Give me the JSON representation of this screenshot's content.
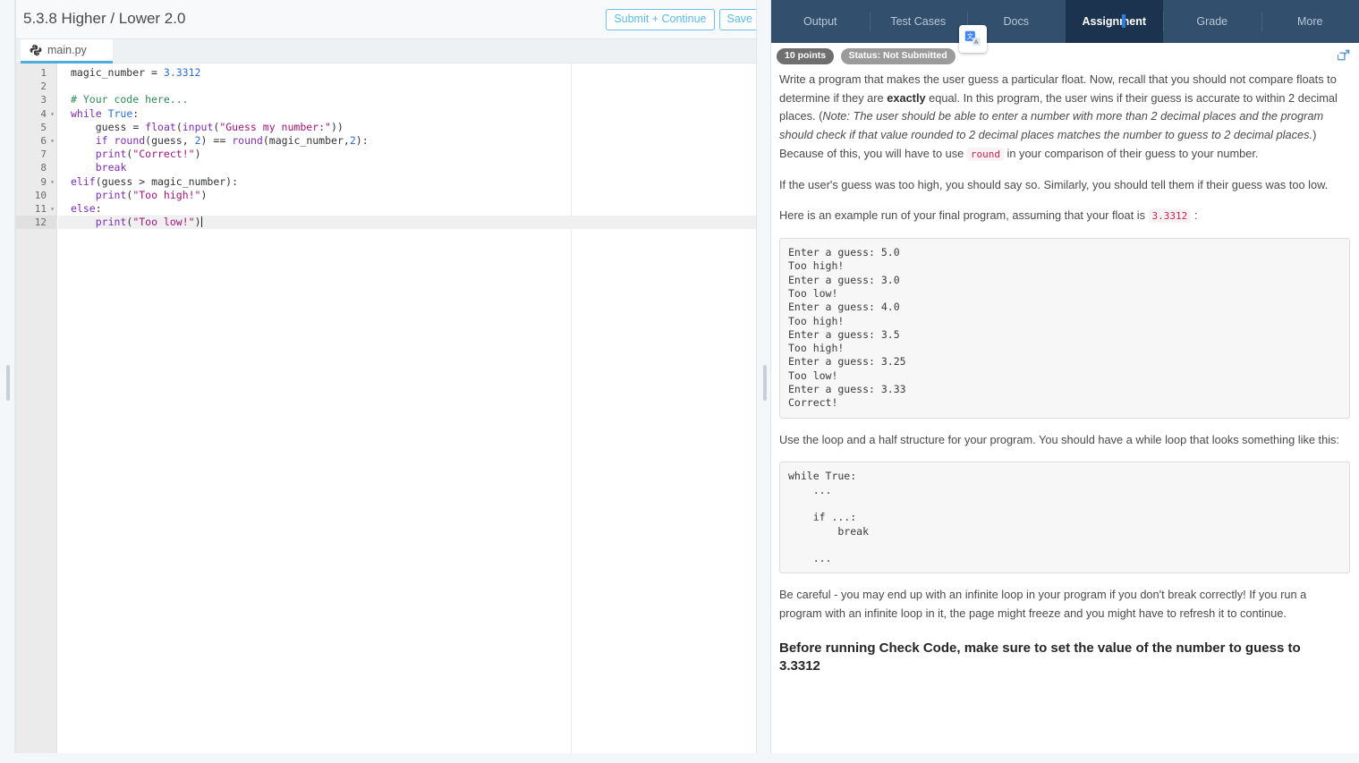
{
  "editor": {
    "title": "5.3.8 Higher / Lower 2.0",
    "submit_label": "Submit + Continue",
    "save_label": "Save",
    "file_tab": "main.py",
    "active_line": 12,
    "lines": [
      {
        "n": 1,
        "fold": false
      },
      {
        "n": 2,
        "fold": false
      },
      {
        "n": 3,
        "fold": false
      },
      {
        "n": 4,
        "fold": true
      },
      {
        "n": 5,
        "fold": false
      },
      {
        "n": 6,
        "fold": true
      },
      {
        "n": 7,
        "fold": false
      },
      {
        "n": 8,
        "fold": false
      },
      {
        "n": 9,
        "fold": true
      },
      {
        "n": 10,
        "fold": false
      },
      {
        "n": 11,
        "fold": true
      },
      {
        "n": 12,
        "fold": false
      }
    ],
    "code": [
      "magic_number = 3.3312",
      "",
      "# Your code here...",
      "while True:",
      "    guess = float(input(\"Guess my number:\"))",
      "    if round(guess, 2) == round(magic_number,2):",
      "    print(\"Correct!\")",
      "    break",
      "elif(guess > magic_number):",
      "    print(\"Too high!\")",
      "else:",
      "    print(\"Too low!\")"
    ]
  },
  "right_panel": {
    "tabs": [
      {
        "label": "Output",
        "active": false
      },
      {
        "label": "Test Cases",
        "active": false
      },
      {
        "label": "Docs",
        "active": false
      },
      {
        "label": "Assignment",
        "active": true
      },
      {
        "label": "Grade",
        "active": false
      },
      {
        "label": "More",
        "active": false
      }
    ],
    "points_badge": "10 points",
    "status_badge": "Status: Not Submitted",
    "popout_icon": "external-link-icon",
    "translate_icon": "google-translate-icon",
    "assignment": {
      "p1_a": "Write a program that makes the user guess a particular float. Now, recall that you should not compare floats to determine if they are ",
      "p1_bold": "exactly",
      "p1_b": " equal. In this program, the user wins if their guess is accurate to within 2 decimal places. (",
      "p1_note_lead": "Note:",
      "p1_note_italic": " The user should be able to enter a number with more than 2 decimal places and the program should check if that value rounded to 2 decimal places matches the number to guess to 2 decimal places.",
      "p1_c": ") Because of this, you will have to use ",
      "p1_code": "round",
      "p1_d": " in your comparison of their guess to your number.",
      "p2": "If the user's guess was too high, you should say so. Similarly, you should tell them if their guess was too low.",
      "p3_a": "Here is an example run of your final program, assuming that your float is ",
      "p3_code": "3.3312",
      "p3_b": " :",
      "example_output": "Enter a guess: 5.0\nToo high!\nEnter a guess: 3.0\nToo low!\nEnter a guess: 4.0\nToo high!\nEnter a guess: 3.5\nToo high!\nEnter a guess: 3.25\nToo low!\nEnter a guess: 3.33\nCorrect!",
      "p4": "Use the loop and a half structure for your program. You should have a while loop that looks something like this:",
      "loop_skeleton": "while True:\n    ...\n\n    if ...:\n        break\n\n    ...",
      "p5": "Be careful - you may end up with an infinite loop in your program if you don't break correctly! If you run a program with an infinite loop in it, the page might freeze and you might have to refresh it to continue.",
      "callout": "Before running Check Code, make sure to set the value of the number to guess to 3.3312"
    }
  },
  "colors": {
    "tabbar_bg": "#32506e",
    "tab_active_bg": "#1c3350",
    "accent_blue": "#4eabdc",
    "badge_points": "#6f6f6f",
    "badge_status": "#9b9b9b",
    "code_keyword": "#7e2ab5",
    "code_string": "#a0147a",
    "code_comment": "#2e8b57",
    "code_number": "#2b6fd1",
    "inline_code": "#c7254e"
  }
}
